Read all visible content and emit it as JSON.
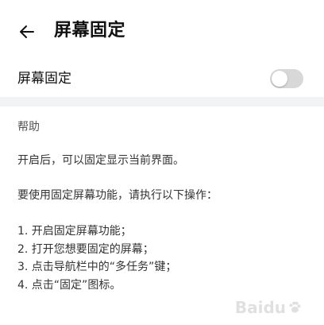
{
  "header": {
    "back_icon": "arrow-left-icon",
    "title": "屏幕固定"
  },
  "setting": {
    "label": "屏幕固定",
    "toggle_on": false
  },
  "help": {
    "title": "帮助",
    "paragraph1": "开启后，可以固定显示当前界面。",
    "paragraph2": "要使用固定屏幕功能，请执行以下操作：",
    "steps": [
      "1. 开启固定屏幕功能；",
      "2. 打开您想要固定的屏幕；",
      "3. 点击导航栏中的“多任务”键；",
      "4. 点击“固定”图标。"
    ]
  },
  "watermark": {
    "text": "Baidu"
  },
  "colors": {
    "background": "#ffffff",
    "separator": "#f1f3f5",
    "toggle_off": "#d8d8d8"
  }
}
